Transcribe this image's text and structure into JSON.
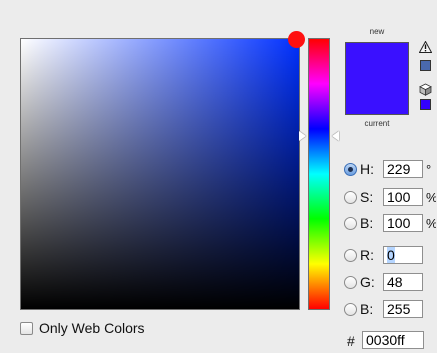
{
  "colors": {
    "hue_base": "#0030ff",
    "new_color": "#3a10ff",
    "current_color": "#3a10ff",
    "gamut_swatch": "#4a69ad",
    "websafe_swatch": "#3300ff"
  },
  "swatch": {
    "new_label": "new",
    "current_label": "current"
  },
  "icons": {
    "warning": "warning-triangle-icon",
    "cube": "web-safe-cube-icon"
  },
  "fields": {
    "hue": {
      "label": "H:",
      "value": "229",
      "unit": "°",
      "selected": true
    },
    "saturation": {
      "label": "S:",
      "value": "100",
      "unit": "%",
      "selected": false
    },
    "brightness": {
      "label": "B:",
      "value": "100",
      "unit": "%",
      "selected": false
    },
    "red": {
      "label": "R:",
      "value": "0",
      "selected": false
    },
    "green": {
      "label": "G:",
      "value": "48",
      "selected": false
    },
    "blue": {
      "label": "B:",
      "value": "255",
      "selected": false
    }
  },
  "hex": {
    "symbol": "#",
    "value": "0030ff"
  },
  "web_colors": {
    "label": "Only Web Colors",
    "checked": false
  }
}
